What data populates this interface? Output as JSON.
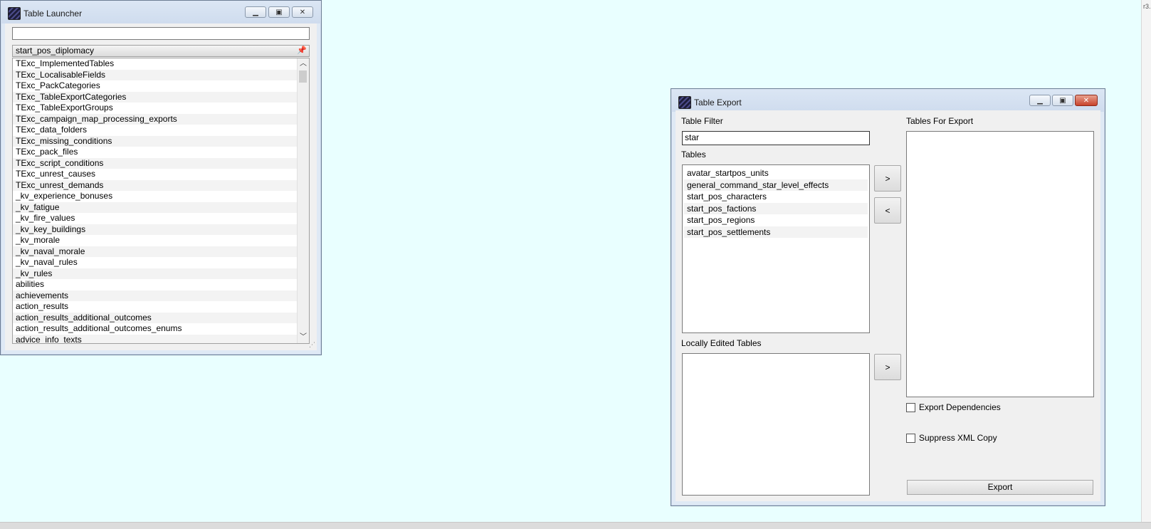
{
  "launcher": {
    "title": "Table Launcher",
    "search_value": "",
    "list_header": "start_pos_diplomacy",
    "items": [
      "TExc_ImplementedTables",
      "TExc_LocalisableFields",
      "TExc_PackCategories",
      "TExc_TableExportCategories",
      "TExc_TableExportGroups",
      "TExc_campaign_map_processing_exports",
      "TExc_data_folders",
      "TExc_missing_conditions",
      "TExc_pack_files",
      "TExc_script_conditions",
      "TExc_unrest_causes",
      "TExc_unrest_demands",
      "_kv_experience_bonuses",
      "_kv_fatigue",
      "_kv_fire_values",
      "_kv_key_buildings",
      "_kv_morale",
      "_kv_naval_morale",
      "_kv_naval_rules",
      "_kv_rules",
      "abilities",
      "achievements",
      "action_results",
      "action_results_additional_outcomes",
      "action_results_additional_outcomes_enums",
      "advice_info_texts"
    ]
  },
  "export": {
    "title": "Table Export",
    "table_filter_label": "Table Filter",
    "table_filter_value": "star",
    "tables_label": "Tables",
    "tables": [
      "avatar_startpos_units",
      "general_command_star_level_effects",
      "start_pos_characters",
      "start_pos_factions",
      "start_pos_regions",
      "start_pos_settlements"
    ],
    "tables_for_export_label": "Tables For Export",
    "locally_edited_label": "Locally Edited Tables",
    "add_label": ">",
    "remove_label": "<",
    "add_local_label": ">",
    "export_dependencies_label": "Export Dependencies",
    "suppress_xml_label": "Suppress XML Copy",
    "export_button_label": "Export"
  },
  "edge_text": "r3."
}
